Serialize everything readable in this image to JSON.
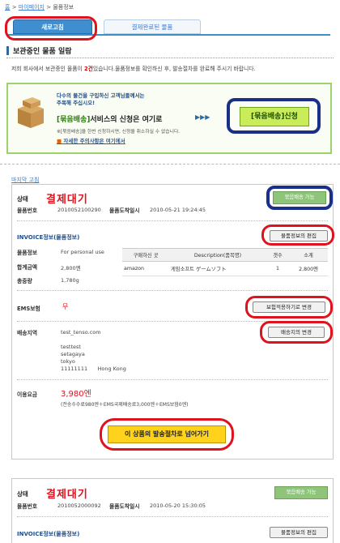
{
  "breadcrumb": {
    "home": "홈",
    "mypage": "마이페이지",
    "current": "물품정보",
    "sep": ">"
  },
  "tabs": [
    {
      "label": "새로고침"
    },
    {
      "label": "결제완료된 물품"
    }
  ],
  "section": {
    "title": "보관중인 물품 일람",
    "intro_before": "저희 회사에서 보관중인 물품이 ",
    "intro_count": "2건",
    "intro_after": "있습니다.물품정보를 확인하신 후, 발송절차를 완료해 주시기 바랍니다."
  },
  "banner": {
    "small_line1": "다수의 물건을 구입하신 고객님들께서는",
    "small_line2": "주목해 주십시오!",
    "main_prefix": "[묶음배송]",
    "main_suffix": "서비스의 신청은 여기로",
    "arrows": "▶▶▶",
    "note": "※[묶음배송]을 한번 신청하시면, 신청을 취소하실 수 없습니다.",
    "link": "자세한 주의사항은 여기에서",
    "apply_button": "[묶음배송]신청"
  },
  "top_link": "마지막 고침",
  "orders": [
    {
      "status_label": "상태",
      "status_value": "결제대기",
      "bundle_button": "묶음배송 가능",
      "item_no_label": "물품번호",
      "item_no": "2010052100290",
      "arrival_label": "물품도착일시",
      "arrival": "2010-05-21 19:24:45",
      "invoice_title": "INVOICE정보(물품정보)",
      "edit_button": "물품정보의 편집",
      "info_label": "물품정보",
      "info_value": "For personal use",
      "total_label": "합계금액",
      "total_value": "2,800엔",
      "weight_label": "총중량",
      "weight_value": "1,780g",
      "table": {
        "headers": [
          "구매하신 곳",
          "Description(품목명)",
          "갯수",
          "소계"
        ],
        "rows": [
          [
            "amazon",
            "게임소프트 ゲームソフト",
            "1",
            "2,800엔"
          ]
        ]
      },
      "ems_label": "EMS보험",
      "ems_value": "무",
      "ems_button": "보험적용하기로 변경",
      "addr_label": "배송지역",
      "addr_button": "배송지의 변경",
      "addr_lines": [
        "test_tenso.com",
        "",
        "testtest",
        "setagaya",
        "tokyo",
        "11111111      Hong Kong"
      ],
      "fee_label": "이용요금",
      "fee_value": "3,980엔",
      "fee_detail": "(전송수수료980엔＋EMS국제배송료3,000엔＋EMS보험0엔)",
      "cta": "이 상품의 발송절차로 넘어가기"
    },
    {
      "status_label": "상태",
      "status_value": "결제대기",
      "bundle_button": "묶음배송 가능",
      "item_no_label": "물품번호",
      "item_no": "2010052000092",
      "arrival_label": "물품도착일시",
      "arrival": "2010-05-20 15:30:05",
      "invoice_title": "INVOICE정보(물품정보)",
      "edit_button": "물품정보의 편집"
    }
  ],
  "colors": {
    "accent_red": "#e0121e",
    "tab_blue": "#3e8ed0",
    "banner_green": "#9bd36a",
    "highlight_ring_red": "#e0121e",
    "highlight_ring_navy": "#1a2f8a"
  }
}
